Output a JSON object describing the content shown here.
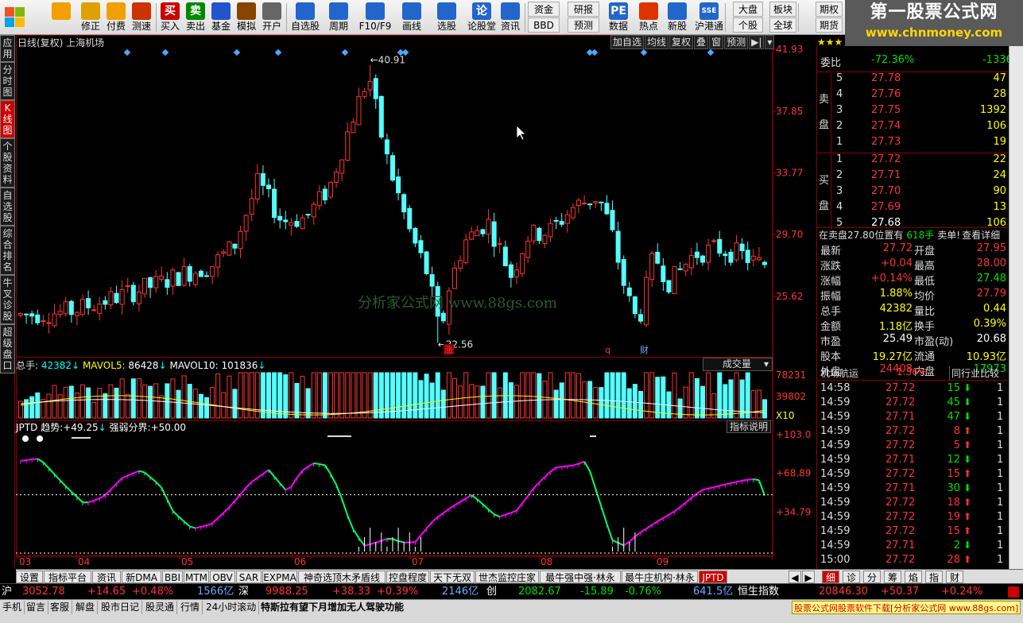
{
  "toolbar": {
    "items": [
      {
        "name": "back-button",
        "icon": "arrow-left-icon",
        "label": "",
        "color": "#f0a000"
      },
      {
        "name": "modify-button",
        "icon": "arrow-updown-icon",
        "label": "修正",
        "color": "#e0a000"
      },
      {
        "name": "pay-button",
        "icon": "coin-icon",
        "label": "付费",
        "color": "#f0a000"
      },
      {
        "name": "speed-test-button",
        "icon": "clock-icon",
        "label": "测速",
        "color": "#cc3300"
      },
      {
        "name": "buy-button",
        "icon": "buy-icon",
        "label": "买入",
        "glyph": "买",
        "color": "#cc0000"
      },
      {
        "name": "sell-button",
        "icon": "sell-icon",
        "label": "卖出",
        "glyph": "卖",
        "color": "#008800"
      },
      {
        "name": "fund-button",
        "icon": "fund-icon",
        "label": "基金",
        "color": "#2255cc"
      },
      {
        "name": "simulate-button",
        "icon": "hammer-icon",
        "label": "模拟",
        "color": "#884400"
      },
      {
        "name": "open-account-button",
        "icon": "lock-icon",
        "label": "开户",
        "color": "#666666"
      },
      {
        "name": "watchlist-button",
        "icon": "star-icon",
        "label": "自选股",
        "color": "#2266cc"
      },
      {
        "name": "period-button",
        "icon": "clock-icon",
        "label": "周期",
        "color": "#2266cc"
      },
      {
        "name": "f10-button",
        "icon": "document-icon",
        "label": "F10/F9",
        "color": "#2266cc"
      },
      {
        "name": "draw-button",
        "icon": "pencil-icon",
        "label": "画线",
        "color": "#2266cc"
      },
      {
        "name": "select-stock-button",
        "icon": "chart-icon",
        "label": "选股",
        "color": "#2266cc"
      },
      {
        "name": "forum-button",
        "icon": "forum-icon",
        "label": "论股堂",
        "glyph": "论",
        "color": "#2266cc"
      },
      {
        "name": "news-button",
        "icon": "news-icon",
        "label": "资讯",
        "color": "#2266cc"
      },
      {
        "name": "data-button",
        "icon": "pe-icon",
        "label": "数据",
        "glyph": "PE",
        "color": "#2266cc"
      },
      {
        "name": "hot-button",
        "icon": "fire-icon",
        "label": "热点",
        "color": "#dd3300"
      },
      {
        "name": "ipo-button",
        "icon": "newstock-icon",
        "label": "新股",
        "color": "#2266cc"
      },
      {
        "name": "hk-connect-button",
        "icon": "hk-icon",
        "label": "沪港通",
        "glyph": "SSE",
        "color": "#2266cc"
      }
    ],
    "pills": [
      {
        "name": "funds-pill",
        "label": "资金"
      },
      {
        "name": "bbd-pill",
        "label": "BBD"
      },
      {
        "name": "research-pill",
        "label": "研报"
      },
      {
        "name": "forecast-pill",
        "label": "预测"
      },
      {
        "name": "market-pill",
        "label": "大盘"
      },
      {
        "name": "stock-pill",
        "label": "个股"
      },
      {
        "name": "sector-pill",
        "label": "板块"
      },
      {
        "name": "global-pill",
        "label": "全球"
      },
      {
        "name": "futures-pill",
        "label": "期权"
      },
      {
        "name": "futures2-pill",
        "label": "期货"
      }
    ]
  },
  "watermark": {
    "title": "第一股票公式网",
    "url": "www.chnmoney.com"
  },
  "left_tabs": [
    {
      "label": "应用",
      "active": false
    },
    {
      "label": "分时图",
      "active": false
    },
    {
      "label": "K线图",
      "active": true
    },
    {
      "label": "个股资料",
      "active": false
    },
    {
      "label": "自选股",
      "active": false
    },
    {
      "label": "综合排名",
      "active": false
    },
    {
      "label": "牛叉诊股",
      "active": false
    },
    {
      "label": "超级盘口",
      "active": false
    }
  ],
  "kline": {
    "title": "日线(复权) 上海机场",
    "buttons": [
      "加自选",
      "均线",
      "复权",
      "叠",
      "窗",
      "预测"
    ],
    "high_label": "40.91",
    "low_label": "22.56",
    "yticks": [
      "41.93",
      "37.85",
      "33.77",
      "29.70",
      "25.62"
    ],
    "watermark": "分析家公式网  www.88gs.com",
    "markers": [
      "涨",
      "q",
      "财"
    ]
  },
  "volume": {
    "label": "总手:",
    "value": "42382",
    "ma5_label": "MAVOL5:",
    "ma5": "86428",
    "ma10_label": "MAVOL10:",
    "ma10": "101836",
    "dropdown": "成交量",
    "yticks": [
      "78231",
      "39802",
      "X10"
    ]
  },
  "jptd": {
    "name": "JPTD",
    "trend_label": "趋势:",
    "trend": "+49.25",
    "line_label": "强弱分界:",
    "line": "+50.00",
    "explain": "指标说明",
    "yticks": [
      "+103.0",
      "+68.89",
      "+34.79"
    ]
  },
  "xaxis": [
    "03",
    "04",
    "05",
    "06",
    "07",
    "08",
    "09"
  ],
  "quote": {
    "title": "上海机场",
    "ratio_label": "委比",
    "ratio": "-72.36%",
    "diff": "-1336",
    "sell_label": "卖盘",
    "buy_label": "买盘",
    "sells": [
      {
        "lv": "5",
        "p": "27.78",
        "v": "47"
      },
      {
        "lv": "4",
        "p": "27.76",
        "v": "28"
      },
      {
        "lv": "3",
        "p": "27.75",
        "v": "1392"
      },
      {
        "lv": "2",
        "p": "27.74",
        "v": "106"
      },
      {
        "lv": "1",
        "p": "27.73",
        "v": "19"
      }
    ],
    "buys": [
      {
        "lv": "1",
        "p": "27.72",
        "v": "22"
      },
      {
        "lv": "2",
        "p": "27.71",
        "v": "24"
      },
      {
        "lv": "3",
        "p": "27.70",
        "v": "90"
      },
      {
        "lv": "4",
        "p": "27.69",
        "v": "13"
      },
      {
        "lv": "5",
        "p": "27.68",
        "v": "106"
      }
    ],
    "notice_a": "在卖盘27.80位置有",
    "notice_b": "618手",
    "notice_c": "卖单!",
    "notice_d": "查看详细",
    "stats": [
      {
        "l1": "最新",
        "v1": "27.72",
        "c1": "red",
        "l2": "开盘",
        "v2": "27.95",
        "c2": "red"
      },
      {
        "l1": "涨跌",
        "v1": "+0.04",
        "c1": "red",
        "l2": "最高",
        "v2": "28.00",
        "c2": "red"
      },
      {
        "l1": "涨幅",
        "v1": "+0.14%",
        "c1": "red",
        "l2": "最低",
        "v2": "27.48",
        "c2": "grn"
      },
      {
        "l1": "振幅",
        "v1": "1.88%",
        "c1": "yel",
        "l2": "均价",
        "v2": "27.79",
        "c2": "red"
      },
      {
        "l1": "总手",
        "v1": "42382",
        "c1": "yel",
        "l2": "量比",
        "v2": "0.44",
        "c2": "yel"
      },
      {
        "l1": "金额",
        "v1": "1.18亿",
        "c1": "yel",
        "l2": "换手",
        "v2": "0.39%",
        "c2": "yel"
      },
      {
        "l1": "市盈",
        "v1": "25.49",
        "c1": "wht",
        "l2": "市盈(动)",
        "v2": "20.68",
        "c2": "wht"
      },
      {
        "l1": "股本",
        "v1": "19.27亿",
        "c1": "yel",
        "l2": "流通",
        "v2": "10.93亿",
        "c2": "yel"
      },
      {
        "l1": "外盘",
        "v1": "24408",
        "c1": "red",
        "l2": "内盘",
        "v2": "17973",
        "c2": "grn"
      }
    ],
    "sector": "机场航运",
    "sector_change": "1.36%",
    "compare": "同行业比较",
    "ticks": [
      {
        "t": "14:58",
        "p": "27.72",
        "v": "15",
        "d": "down",
        "n": "1"
      },
      {
        "t": "14:59",
        "p": "27.72",
        "v": "45",
        "d": "down",
        "n": "1"
      },
      {
        "t": "14:59",
        "p": "27.71",
        "v": "47",
        "d": "down",
        "n": "1"
      },
      {
        "t": "14:59",
        "p": "27.72",
        "v": "8",
        "d": "up",
        "n": "1"
      },
      {
        "t": "14:59",
        "p": "27.72",
        "v": "5",
        "d": "up",
        "n": "1"
      },
      {
        "t": "14:59",
        "p": "27.71",
        "v": "12",
        "d": "down",
        "n": "1"
      },
      {
        "t": "14:59",
        "p": "27.72",
        "v": "15",
        "d": "up",
        "n": "1"
      },
      {
        "t": "14:59",
        "p": "27.71",
        "v": "30",
        "d": "down",
        "n": "1"
      },
      {
        "t": "14:59",
        "p": "27.72",
        "v": "18",
        "d": "up",
        "n": "1"
      },
      {
        "t": "14:59",
        "p": "27.72",
        "v": "19",
        "d": "up",
        "n": "1"
      },
      {
        "t": "14:59",
        "p": "27.72",
        "v": "15",
        "d": "up",
        "n": "1"
      },
      {
        "t": "14:59",
        "p": "27.71",
        "v": "2",
        "d": "down",
        "n": "1"
      },
      {
        "t": "15:00",
        "p": "27.72",
        "v": "28",
        "d": "up",
        "n": "1"
      }
    ]
  },
  "bottom_tabs": [
    {
      "label": "设置",
      "active": false
    },
    {
      "label": "指标平台",
      "active": false
    },
    {
      "label": "资讯",
      "active": false
    },
    {
      "label": "新DMA",
      "active": false
    },
    {
      "label": "BBI",
      "active": false
    },
    {
      "label": "MTM",
      "active": false
    },
    {
      "label": "OBV",
      "active": false
    },
    {
      "label": "SAR",
      "active": false
    },
    {
      "label": "EXPMA",
      "active": false
    },
    {
      "label": "神奇选顶木矛盾线",
      "active": false
    },
    {
      "label": "控盘程度",
      "active": false
    },
    {
      "label": "天下无双",
      "active": false
    },
    {
      "label": "世杰监控庄家",
      "active": false
    },
    {
      "label": "最牛强中强·林永",
      "active": false
    },
    {
      "label": "最牛庄机构·林永",
      "active": false
    },
    {
      "label": "JPTD",
      "active": true
    }
  ],
  "right_tabs": [
    "细",
    "诊",
    "分",
    "筹",
    "焰",
    "指",
    "财"
  ],
  "indices": [
    {
      "name": "沪",
      "value": "3052.78",
      "chg": "+14.65",
      "pct": "+0.48%",
      "amt": "1566亿"
    },
    {
      "name": "深",
      "value": "9988.25",
      "chg": "+38.33",
      "pct": "+0.39%",
      "amt": "2146亿"
    },
    {
      "name": "创",
      "value": "2082.67",
      "chg": "-15.89",
      "pct": "-0.76%",
      "amt": "641.5亿"
    },
    {
      "name": "恒生指数",
      "value": "20846.30",
      "chg": "+50.37",
      "pct": "+0.24%",
      "amt": ""
    }
  ],
  "status": {
    "items": [
      "手机",
      "留言",
      "客服",
      "解盘",
      "股市日记",
      "股灵通",
      "行情",
      "24小时滚动"
    ],
    "news": "特斯拉有望下月增加无人驾驶功能",
    "ad": "股票公式网股票软件下载[分析家公式网 www.88gs.com]"
  },
  "chart_data": {
    "type": "candlestick",
    "title": "日线(复权) 上海机场",
    "x_months": [
      "03",
      "04",
      "05",
      "06",
      "07",
      "08",
      "09"
    ],
    "ylim": [
      21.9,
      41.93
    ],
    "high": 40.91,
    "low": 22.56,
    "last": 27.72,
    "volume_max": 78231,
    "jptd_range": [
      0,
      103.0
    ],
    "jptd_threshold": 50.0,
    "jptd_last": 49.25
  }
}
